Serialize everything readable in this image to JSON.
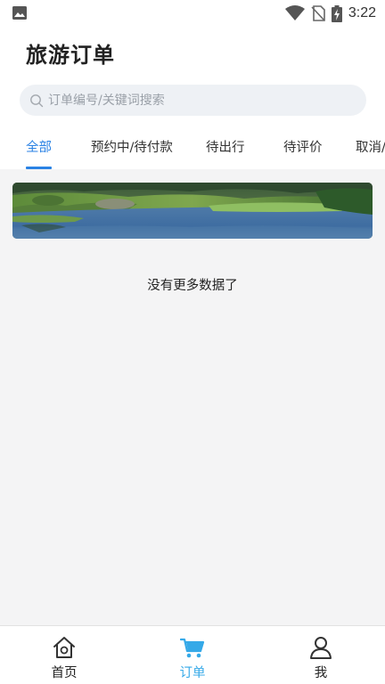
{
  "status_bar": {
    "time": "3:22",
    "icons": [
      "gallery-icon",
      "wifi-icon",
      "no-sim-icon",
      "battery-charging-icon"
    ]
  },
  "header": {
    "title": "旅游订单"
  },
  "search": {
    "placeholder": "订单编号/关键词搜索",
    "icon": "search-icon"
  },
  "tabs": [
    {
      "label": "全部",
      "active": true
    },
    {
      "label": "预约中/待付款",
      "active": false
    },
    {
      "label": "待出行",
      "active": false
    },
    {
      "label": "待评价",
      "active": false
    },
    {
      "label": "取消/"
    }
  ],
  "banner": {
    "image": "lake-landscape-banner"
  },
  "list": {
    "empty_text": "没有更多数据了"
  },
  "bottom_nav": [
    {
      "label": "首页",
      "icon": "home-icon",
      "active": false
    },
    {
      "label": "订单",
      "icon": "cart-icon",
      "active": true
    },
    {
      "label": "我",
      "icon": "user-icon",
      "active": false
    }
  ],
  "colors": {
    "accent": "#2a82e4",
    "nav_active": "#35a9e8",
    "background": "#f4f4f5"
  }
}
